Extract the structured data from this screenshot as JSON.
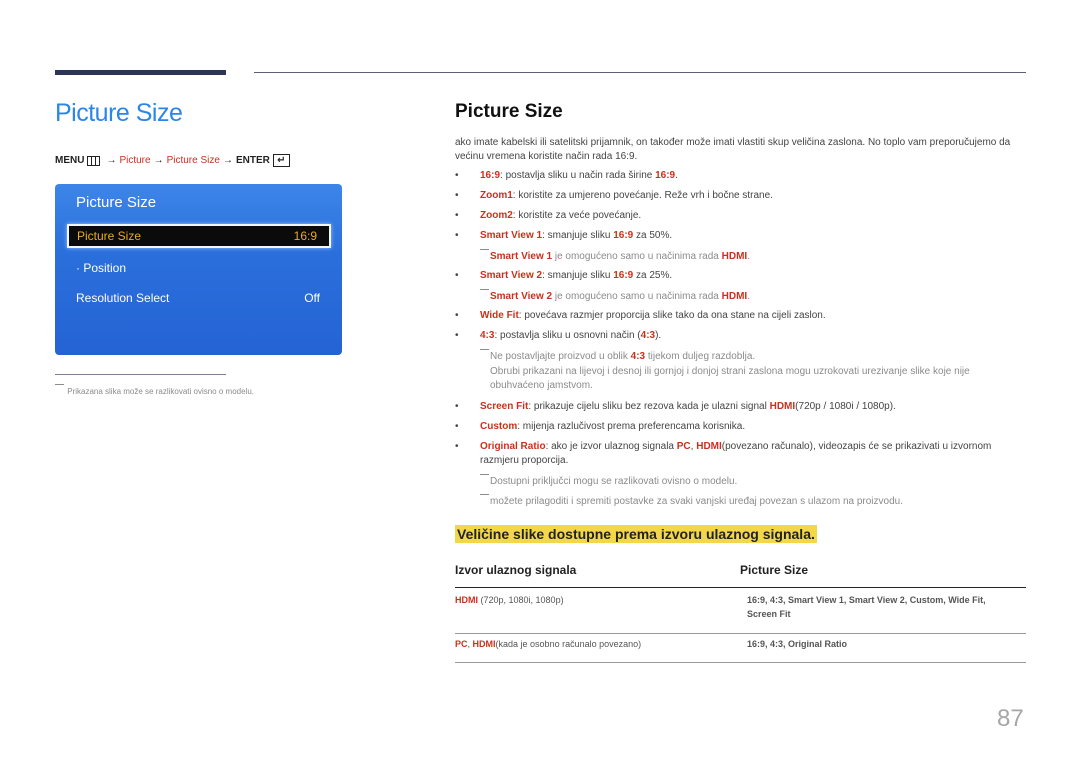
{
  "left": {
    "title": "Picture Size",
    "menu_path": {
      "menu": "MENU",
      "arrow": "→",
      "picture": "Picture",
      "picture_size": "Picture Size",
      "enter": "ENTER",
      "enter_icon": "↵"
    },
    "osd": {
      "title": "Picture Size",
      "selected_item": {
        "label": "Picture Size",
        "value": "16:9"
      },
      "items": [
        {
          "label": "· Position",
          "value": ""
        },
        {
          "label": "Resolution Select",
          "value": "Off"
        }
      ]
    },
    "note": "Prikazana slika može se razlikovati ovisno o modelu."
  },
  "right": {
    "title": "Picture Size",
    "intro": "ako imate kabelski ili satelitski prijamnik, on također može imati vlastiti skup veličina zaslona. No toplo vam preporučujemo da većinu vremena koristite način rada 16:9.",
    "bullet": "•",
    "items": [
      {
        "key": "16:9",
        "text": ": postavlja sliku u način rada širine ",
        "key2": "16:9",
        "tail": "."
      },
      {
        "key": "Zoom1",
        "text": ": koristite za umjereno povećanje. Reže vrh i bočne strane."
      },
      {
        "key": "Zoom2",
        "text": ": koristite za veće povećanje."
      },
      {
        "key": "Smart View 1",
        "text": ": smanjuje sliku ",
        "key2": "16:9",
        "tail": " za 50%."
      },
      {
        "key": "Smart View 2",
        "text": ": smanjuje sliku ",
        "key2": "16:9",
        "tail": " za 25%."
      },
      {
        "key": "Wide Fit",
        "text": ": povećava razmjer proporcija slike tako da ona stane na cijeli zaslon."
      },
      {
        "key": "4:3",
        "text": ": postavlja sliku u osnovni način (",
        "key2": "4:3",
        "tail": ")."
      },
      {
        "key": "Screen Fit",
        "text": ": prikazuje cijelu sliku bez rezova kada je ulazni signal ",
        "key2": "HDMI",
        "tail": "(720p / 1080i / 1080p)."
      },
      {
        "key": "Custom",
        "text": ": mijenja razlučivost prema preferencama korisnika."
      },
      {
        "key": "Original Ratio",
        "text": ": ako je izvor ulaznog signala ",
        "key2": "PC",
        "mid": ", ",
        "key3": "HDMI",
        "tail": "(povezano računalo), videozapis će se prikazivati u izvornom razmjeru proporcija."
      }
    ],
    "notes": {
      "sv1": {
        "key": "Smart View 1",
        "text": " je omogućeno samo u načinima rada ",
        "key2": "HDMI",
        "tail": "."
      },
      "sv2": {
        "key": "Smart View 2",
        "text": " je omogućeno samo u načinima rada ",
        "key2": "HDMI",
        "tail": "."
      },
      "r43_a": {
        "text": "Ne postavljajte proizvod u oblik ",
        "key": "4:3",
        "tail": " tijekom duljeg razdoblja."
      },
      "r43_b": "Obrubi prikazani na lijevoj i desnoj ili gornjoj i donjoj strani zaslona mogu uzrokovati urezivanje slike koje nije obuhvaćeno jamstvom.",
      "ports": "Dostupni priključci mogu se razlikovati ovisno o modelu.",
      "save": "možete prilagoditi i spremiti postavke za svaki vanjski uređaj povezan s ulazom na proizvodu."
    },
    "section_heading": "Veličine slike dostupne prema izvoru ulaznog signala.",
    "table": {
      "headers": [
        "Izvor ulaznog signala",
        "Picture Size"
      ],
      "rows": [
        {
          "source_key": "HDMI",
          "source_text": " (720p, 1080i, 1080p)",
          "sizes_line1": "16:9, 4:3, Smart View 1, Smart View 2, Custom, Wide Fit,",
          "sizes_line2": "Screen Fit"
        },
        {
          "source_key": "PC",
          "source_sep": ", ",
          "source_key2": "HDMI",
          "source_text": "(kada je osobno računalo povezano)",
          "sizes_line1": "16:9, 4:3, Original Ratio"
        }
      ]
    }
  },
  "page_number": "87"
}
